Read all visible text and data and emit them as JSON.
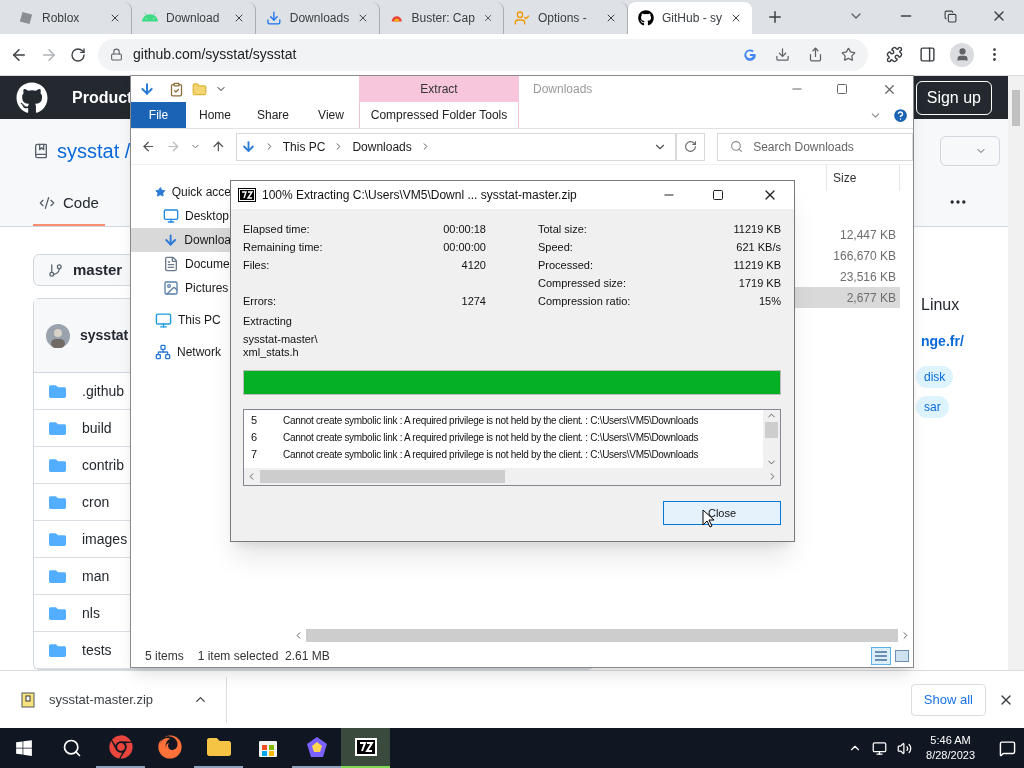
{
  "browser": {
    "tabs": [
      {
        "title": "Roblox",
        "kind": "roblox",
        "selected": false
      },
      {
        "title": "Download",
        "kind": "android",
        "selected": false
      },
      {
        "title": "Downloads",
        "kind": "download",
        "selected": false
      },
      {
        "title": "Buster: Cap",
        "kind": "buster",
        "selected": false
      },
      {
        "title": "Options -",
        "kind": "person",
        "selected": false
      },
      {
        "title": "GitHub - sy",
        "kind": "github",
        "selected": true
      }
    ],
    "url": "github.com/sysstat/sysstat"
  },
  "github": {
    "nav": "Product",
    "signup": "Sign up",
    "owner": "sysstat /",
    "tab": "Code",
    "branch": "master",
    "commit_author": "sysstat",
    "folders": [
      ".github",
      "build",
      "contrib",
      "cron",
      "images",
      "man",
      "nls",
      "tests"
    ],
    "about": "Linux",
    "link": "nge.fr/",
    "topics": [
      "disk",
      "sar"
    ]
  },
  "explorer": {
    "context_tab": "Extract",
    "title": "Downloads",
    "ribbon_tabs": [
      {
        "label": "File",
        "kind": "file"
      },
      {
        "label": "Home",
        "kind": "plain"
      },
      {
        "label": "Share",
        "kind": "plain"
      },
      {
        "label": "View",
        "kind": "plain"
      },
      {
        "label": "Compressed Folder Tools",
        "kind": "context"
      }
    ],
    "path": [
      "This PC",
      "Downloads"
    ],
    "search": {
      "placeholder": "Search Downloads"
    },
    "nav": [
      {
        "label": "Quick acce",
        "kind": "star",
        "selected": false,
        "children": [
          {
            "label": "Desktop",
            "kind": "desktop",
            "selected": false
          },
          {
            "label": "Downloa",
            "kind": "download",
            "selected": true
          },
          {
            "label": "Docume",
            "kind": "document",
            "selected": false
          },
          {
            "label": "Pictures",
            "kind": "pictures",
            "selected": false
          }
        ]
      },
      {
        "label": "This PC",
        "kind": "pc",
        "selected": false
      },
      {
        "label": "Network",
        "kind": "network",
        "selected": false
      }
    ],
    "size_header": "Size",
    "files": [
      {
        "size": "12,447 KB",
        "selected": false
      },
      {
        "size": "166,670 KB",
        "selected": false
      },
      {
        "size": "23,516 KB",
        "selected": false
      },
      {
        "size": "2,677 KB",
        "selected": true
      }
    ],
    "status": [
      "5 items",
      "1 item selected  2.61 MB"
    ]
  },
  "dialog": {
    "title": "100% Extracting C:\\Users\\VM5\\Downl ... sysstat-master.zip",
    "left_stats": [
      {
        "label": "Elapsed time:",
        "value": "00:00:18"
      },
      {
        "label": "Remaining time:",
        "value": "00:00:00"
      },
      {
        "label": "Files:",
        "value": "4120"
      },
      {
        "label": "Errors:",
        "value": "1274"
      }
    ],
    "right_stats": [
      {
        "label": "Total size:",
        "value": "11219 KB"
      },
      {
        "label": "Speed:",
        "value": "621 KB/s"
      },
      {
        "label": "Processed:",
        "value": "11219 KB"
      },
      {
        "label": "Compressed size:",
        "value": "1719 KB"
      },
      {
        "label": "Compression ratio:",
        "value": "15%"
      }
    ],
    "status": "Extracting",
    "current_file": [
      "sysstat-master\\",
      "xml_stats.h"
    ],
    "progress": {
      "level": 1
    },
    "log": [
      {
        "number": "5",
        "message": "Cannot create symbolic link : A required privilege is not held by the client. : C:\\Users\\VM5\\Downloads"
      },
      {
        "number": "6",
        "message": "Cannot create symbolic link : A required privilege is not held by the client. : C:\\Users\\VM5\\Downloads"
      },
      {
        "number": "7",
        "message": "Cannot create symbolic link : A required privilege is not held by the client. : C:\\Users\\VM5\\Downloads"
      }
    ],
    "close": "Close"
  },
  "download_bar": {
    "file": "sysstat-master.zip",
    "show_all": "Show all"
  },
  "taskbar": {
    "apps": [
      {
        "kind": "chrome",
        "running": true
      },
      {
        "kind": "firefox",
        "running": false
      },
      {
        "kind": "explorer",
        "running": true
      },
      {
        "kind": "store",
        "running": false
      },
      {
        "kind": "pentagon",
        "running": true
      },
      {
        "kind": "sevenzip",
        "running": true
      }
    ],
    "time": "5:46 AM",
    "date": "8/28/2023"
  }
}
